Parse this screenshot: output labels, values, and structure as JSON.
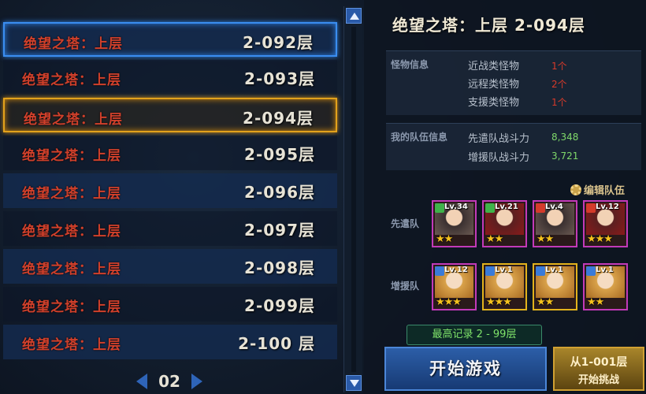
{
  "tower_list": {
    "rows": [
      {
        "name": "绝望之塔：上层",
        "floor": "2-092层"
      },
      {
        "name": "绝望之塔：上层",
        "floor": "2-093层"
      },
      {
        "name": "绝望之塔：上层",
        "floor": "2-094层"
      },
      {
        "name": "绝望之塔：上层",
        "floor": "2-095层"
      },
      {
        "name": "绝望之塔：上层",
        "floor": "2-096层"
      },
      {
        "name": "绝望之塔：上层",
        "floor": "2-097层"
      },
      {
        "name": "绝望之塔：上层",
        "floor": "2-098层"
      },
      {
        "name": "绝望之塔：上层",
        "floor": "2-099层"
      },
      {
        "name": "绝望之塔：上层",
        "floor": "2-100 层"
      }
    ],
    "page": "02"
  },
  "detail": {
    "title": "绝望之塔：上层  2-094层",
    "monster_info_label": "怪物信息",
    "monsters": [
      {
        "type": "近战类怪物",
        "count": "1个"
      },
      {
        "type": "远程类怪物",
        "count": "2个"
      },
      {
        "type": "支援类怪物",
        "count": "1个"
      }
    ],
    "team_info_label": "我的队伍信息",
    "team_power": [
      {
        "label": "先遣队战斗力",
        "value": "8,348"
      },
      {
        "label": "增援队战斗力",
        "value": "3,721"
      }
    ],
    "edit_team": "编辑队伍",
    "vanguard_label": "先遣队",
    "reinforce_label": "增援队",
    "vanguard": [
      {
        "lv": "Lv.34",
        "stars": "★★"
      },
      {
        "lv": "Lv.21",
        "stars": "★★"
      },
      {
        "lv": "Lv.4",
        "stars": "★★"
      },
      {
        "lv": "Lv.12",
        "stars": "★★★"
      }
    ],
    "reinforce": [
      {
        "lv": "Lv.12",
        "stars": "★★★"
      },
      {
        "lv": "Lv.1",
        "stars": "★★★"
      },
      {
        "lv": "Lv.1",
        "stars": "★★"
      },
      {
        "lv": "Lv.1",
        "stars": "★★"
      }
    ],
    "best_record": "最高记录 2 - 99层",
    "start_button": "开始游戏",
    "challenge_line1": "从1-001层",
    "challenge_line2": "开始挑战"
  },
  "colors": {
    "selected_blue": "#3a8df0",
    "selected_gold": "#e2a21c",
    "name_red": "#d1402b"
  }
}
